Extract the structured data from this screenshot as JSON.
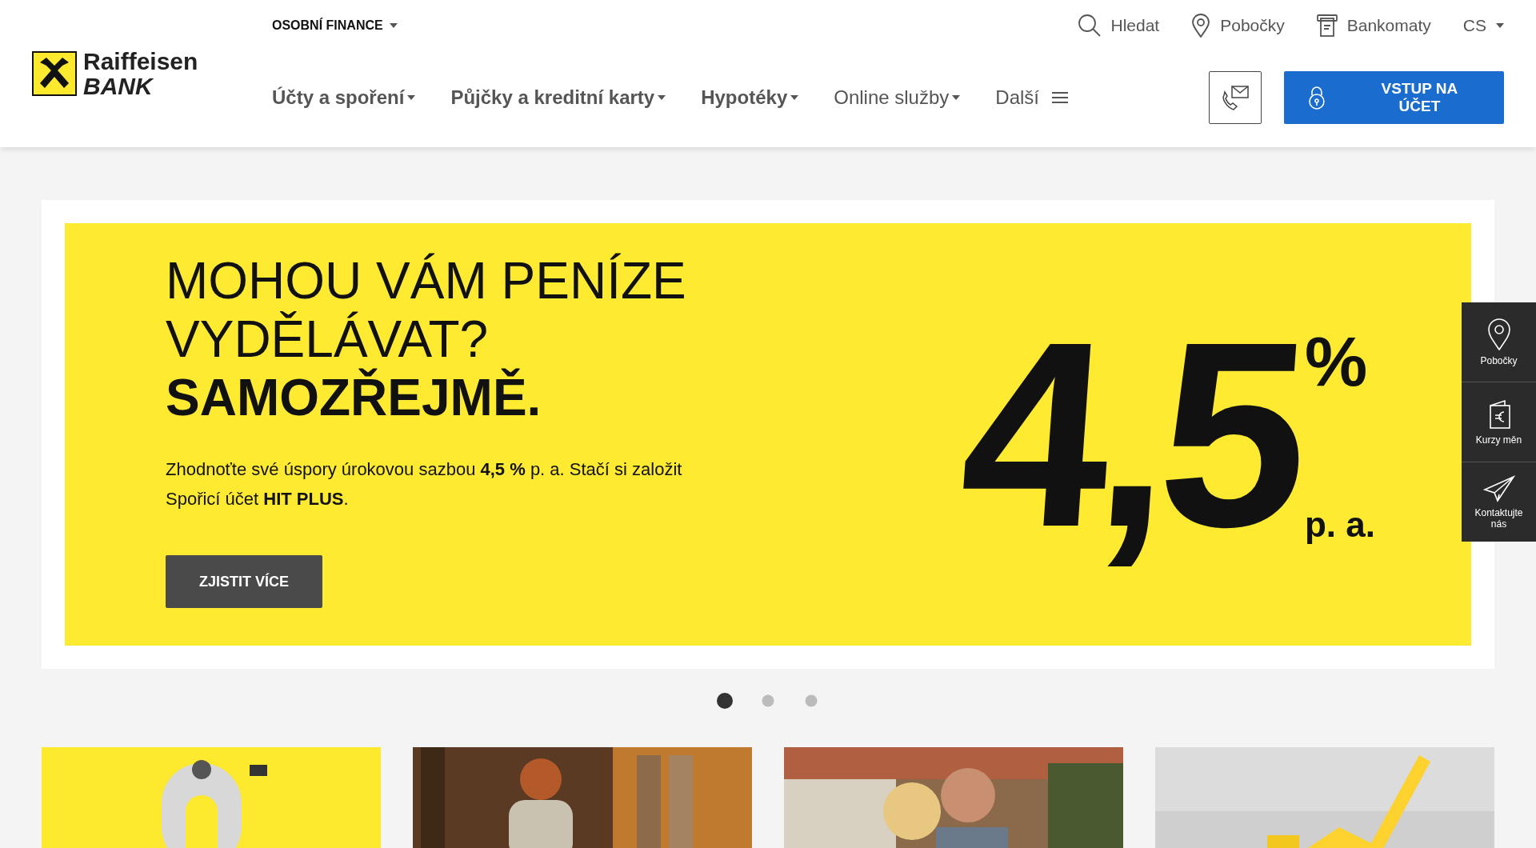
{
  "header": {
    "segment": "OSOBNÍ FINANCE",
    "logo": {
      "line1": "Raiffeisen",
      "line2": "BANK"
    },
    "utility_links": [
      {
        "label": "Hledat"
      },
      {
        "label": "Pobočky"
      },
      {
        "label": "Bankomaty"
      }
    ],
    "language": "CS",
    "nav": [
      {
        "label": "Účty a spoření",
        "kind": "dropdown",
        "bold": true
      },
      {
        "label": "Půjčky a kreditní karty",
        "kind": "dropdown",
        "bold": true
      },
      {
        "label": "Hypotéky",
        "kind": "dropdown",
        "bold": true
      },
      {
        "label": "Online služby",
        "kind": "dropdown",
        "bold": false
      },
      {
        "label": "Další",
        "kind": "menu",
        "bold": false
      }
    ],
    "login_button": "VSTUP NA ÚČET"
  },
  "hero": {
    "title_lines": [
      {
        "text": "MOHOU VÁM PENÍZE",
        "bold": false
      },
      {
        "text": "VYDĚLÁVAT?",
        "bold": false
      },
      {
        "text": "SAMOZŘEJMĚ.",
        "bold": true
      }
    ],
    "text": "Zhodnoťte své úspory úrokovou sazbou **4,5 %** p. a. Stačí si založit Spořicí účet **HIT PLUS**.",
    "button": "ZJISTIT VÍCE",
    "rate": {
      "value": "4,5",
      "unit": "%",
      "period": "p. a."
    }
  },
  "carousel": [
    {
      "selected": true
    },
    {
      "selected": false
    },
    {
      "selected": false
    }
  ],
  "side_panel": [
    {
      "label": "Pobočky"
    },
    {
      "label": "Kurzy měn"
    },
    {
      "label": "Kontaktujte nás"
    }
  ]
}
